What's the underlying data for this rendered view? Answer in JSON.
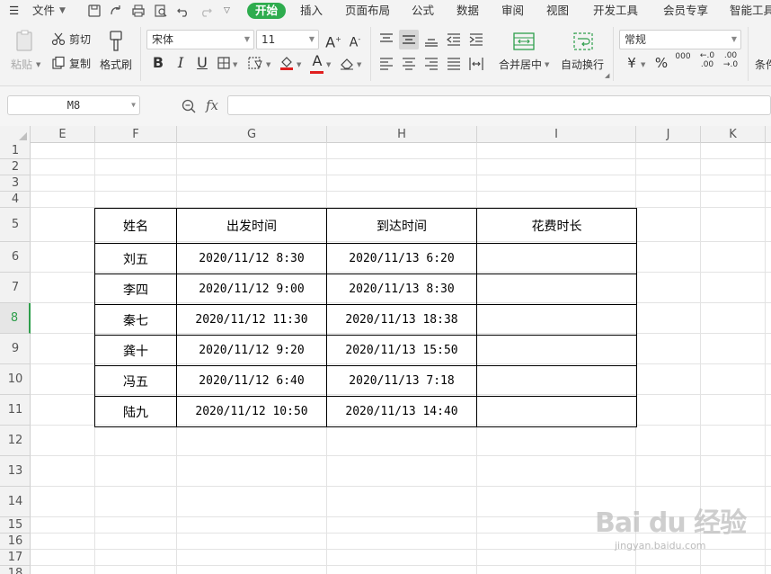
{
  "menubar": {
    "menu_label": "文件",
    "tabs": [
      "开始",
      "插入",
      "页面布局",
      "公式",
      "数据",
      "审阅",
      "视图",
      "开发工具",
      "会员专享",
      "智能工具"
    ],
    "active_tab": "开始"
  },
  "ribbon": {
    "clipboard": {
      "paste": "粘贴",
      "cut": "剪切",
      "copy": "复制",
      "format_painter": "格式刷"
    },
    "font": {
      "name": "宋体",
      "size": "11",
      "bold": "B",
      "italic": "I",
      "underline": "U",
      "font_color_letter": "A"
    },
    "alignment": {
      "merge_center": "合并居中",
      "wrap_text": "自动换行"
    },
    "number": {
      "format": "常规",
      "currency": "¥",
      "percent": "%",
      "thousands": "000",
      "inc_decimal": "←.0\n.00",
      "dec_decimal": ".00\n→.0"
    },
    "conditional_partial": "条件"
  },
  "formula_bar": {
    "name_box": "M8",
    "fx_label": "fx",
    "formula": ""
  },
  "grid": {
    "columns": [
      "E",
      "F",
      "G",
      "H",
      "I",
      "J",
      "K"
    ],
    "rows": [
      "1",
      "2",
      "3",
      "4",
      "5",
      "6",
      "7",
      "8",
      "9",
      "10",
      "11",
      "12",
      "13",
      "14",
      "15",
      "16",
      "17",
      "18"
    ],
    "active_row": "8"
  },
  "table": {
    "headers": [
      "姓名",
      "出发时间",
      "到达时间",
      "花费时长"
    ],
    "rows": [
      [
        "刘五",
        "2020/11/12 8:30",
        "2020/11/13 6:20",
        ""
      ],
      [
        "李四",
        "2020/11/12 9:00",
        "2020/11/13 8:30",
        ""
      ],
      [
        "秦七",
        "2020/11/12 11:30",
        "2020/11/13 18:38",
        ""
      ],
      [
        "龚十",
        "2020/11/12 9:20",
        "2020/11/13 15:50",
        ""
      ],
      [
        "冯五",
        "2020/11/12 6:40",
        "2020/11/13 7:18",
        ""
      ],
      [
        "陆九",
        "2020/11/12 10:50",
        "2020/11/13 14:40",
        ""
      ]
    ]
  },
  "watermark": {
    "brand": "Bai du 经验",
    "url": "jingyan.baidu.com"
  },
  "colors": {
    "accent": "#2eac4e",
    "active_row": "#2e9e4b",
    "font_color_bar": "#e02020"
  }
}
